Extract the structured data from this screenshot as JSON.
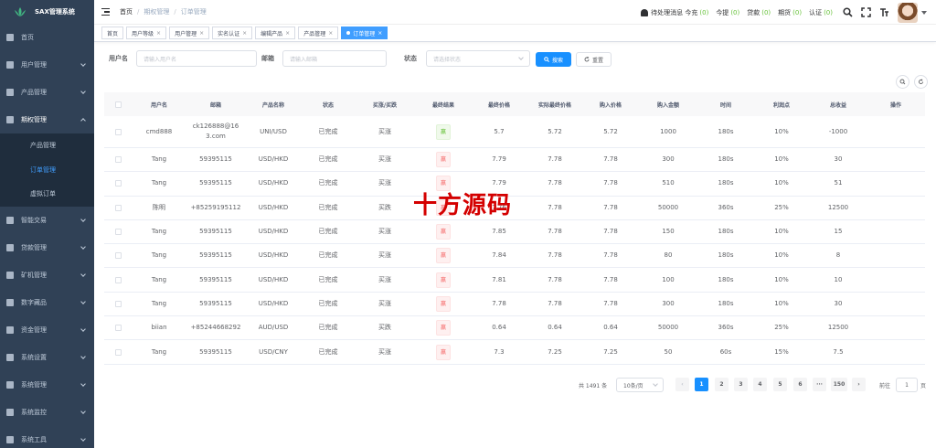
{
  "brand": "SAX管理系统",
  "sidebar": {
    "items": [
      {
        "label": "首页",
        "icon": "dashboard-icon",
        "expandable": false
      },
      {
        "label": "用户管理",
        "icon": "user-icon",
        "expandable": true
      },
      {
        "label": "产品管理",
        "icon": "product-icon",
        "expandable": true
      },
      {
        "label": "期权管理",
        "icon": "option-icon",
        "expandable": true,
        "open": true
      },
      {
        "label": "智能交易",
        "icon": "robot-icon",
        "expandable": true
      },
      {
        "label": "贷款管理",
        "icon": "loan-icon",
        "expandable": true
      },
      {
        "label": "矿机管理",
        "icon": "miner-icon",
        "expandable": true
      },
      {
        "label": "数字藏品",
        "icon": "nft-icon",
        "expandable": true
      },
      {
        "label": "资金管理",
        "icon": "wallet-icon",
        "expandable": true
      },
      {
        "label": "系统设置",
        "icon": "gear-icon",
        "expandable": true
      },
      {
        "label": "系统管理",
        "icon": "settings-icon",
        "expandable": true
      },
      {
        "label": "系统监控",
        "icon": "monitor-icon",
        "expandable": true
      },
      {
        "label": "系统工具",
        "icon": "tool-icon",
        "expandable": true
      }
    ],
    "submenu": [
      "产品管理",
      "订单管理",
      "虚拟订单"
    ]
  },
  "header": {
    "breadcrumb": [
      "首页",
      "期权管理",
      "订单管理"
    ],
    "pending_label": "待处理消息 今充",
    "counters": [
      {
        "label": "今提",
        "value": "(0)"
      },
      {
        "label": "贷款",
        "value": "(0)"
      },
      {
        "label": "期货",
        "value": "(0)"
      },
      {
        "label": "认证",
        "value": "(0)"
      }
    ],
    "pending_value": "(0)"
  },
  "tags": [
    {
      "label": "首页",
      "closable": false
    },
    {
      "label": "用户等级",
      "closable": true
    },
    {
      "label": "用户管理",
      "closable": true
    },
    {
      "label": "实名认证",
      "closable": true
    },
    {
      "label": "编辑产品",
      "closable": true
    },
    {
      "label": "产品管理",
      "closable": true
    },
    {
      "label": "订单管理",
      "closable": true,
      "active": true
    }
  ],
  "search": {
    "username_label": "用户名",
    "username_placeholder": "请输入用户名",
    "email_label": "邮箱",
    "email_placeholder": "请输入邮箱",
    "status_label": "状态",
    "status_placeholder": "请选择状态",
    "search_button": "搜索",
    "reset_button": "重置"
  },
  "table": {
    "columns": [
      "",
      "用户名",
      "邮箱",
      "产品名称",
      "状态",
      "买涨/买跌",
      "最终结果",
      "最终价格",
      "实际最终价格",
      "购入价格",
      "购入金额",
      "时间",
      "利润点",
      "总收益",
      "操作"
    ],
    "rows": [
      {
        "user": "cmd888",
        "email": "ck126888@163.com",
        "product": "UNI/USD",
        "status": "已完成",
        "dir": "买涨",
        "result": "赢",
        "result_type": "win",
        "final": "5.7",
        "actual": "5.72",
        "buy": "5.72",
        "amount": "1000",
        "time": "180s",
        "profit": "10%",
        "total": "-1000"
      },
      {
        "user": "Tang",
        "email": "59395115",
        "product": "USD/HKD",
        "status": "已完成",
        "dir": "买涨",
        "result": "赢",
        "result_type": "lose",
        "final": "7.79",
        "actual": "7.78",
        "buy": "7.78",
        "amount": "300",
        "time": "180s",
        "profit": "10%",
        "total": "30"
      },
      {
        "user": "Tang",
        "email": "59395115",
        "product": "USD/HKD",
        "status": "已完成",
        "dir": "买涨",
        "result": "赢",
        "result_type": "lose",
        "final": "7.79",
        "actual": "7.78",
        "buy": "7.78",
        "amount": "510",
        "time": "180s",
        "profit": "10%",
        "total": "51"
      },
      {
        "user": "陈明",
        "email": "+85259195112",
        "product": "USD/HKD",
        "status": "已完成",
        "dir": "买跌",
        "result": "赢",
        "result_type": "lose",
        "final": "7.76",
        "actual": "7.78",
        "buy": "7.78",
        "amount": "50000",
        "time": "360s",
        "profit": "25%",
        "total": "12500"
      },
      {
        "user": "Tang",
        "email": "59395115",
        "product": "USD/HKD",
        "status": "已完成",
        "dir": "买涨",
        "result": "赢",
        "result_type": "lose",
        "final": "7.85",
        "actual": "7.78",
        "buy": "7.78",
        "amount": "150",
        "time": "180s",
        "profit": "10%",
        "total": "15"
      },
      {
        "user": "Tang",
        "email": "59395115",
        "product": "USD/HKD",
        "status": "已完成",
        "dir": "买涨",
        "result": "赢",
        "result_type": "lose",
        "final": "7.84",
        "actual": "7.78",
        "buy": "7.78",
        "amount": "80",
        "time": "180s",
        "profit": "10%",
        "total": "8"
      },
      {
        "user": "Tang",
        "email": "59395115",
        "product": "USD/HKD",
        "status": "已完成",
        "dir": "买涨",
        "result": "赢",
        "result_type": "lose",
        "final": "7.81",
        "actual": "7.78",
        "buy": "7.78",
        "amount": "100",
        "time": "180s",
        "profit": "10%",
        "total": "10"
      },
      {
        "user": "Tang",
        "email": "59395115",
        "product": "USD/HKD",
        "status": "已完成",
        "dir": "买涨",
        "result": "赢",
        "result_type": "lose",
        "final": "7.78",
        "actual": "7.78",
        "buy": "7.78",
        "amount": "300",
        "time": "180s",
        "profit": "10%",
        "total": "30"
      },
      {
        "user": "biian",
        "email": "+85244668292",
        "product": "AUD/USD",
        "status": "已完成",
        "dir": "买跌",
        "result": "赢",
        "result_type": "lose",
        "final": "0.64",
        "actual": "0.64",
        "buy": "0.64",
        "amount": "50000",
        "time": "360s",
        "profit": "25%",
        "total": "12500"
      },
      {
        "user": "Tang",
        "email": "59395115",
        "product": "USD/CNY",
        "status": "已完成",
        "dir": "买涨",
        "result": "赢",
        "result_type": "lose",
        "final": "7.3",
        "actual": "7.25",
        "buy": "7.25",
        "amount": "50",
        "time": "60s",
        "profit": "15%",
        "total": "7.5"
      }
    ]
  },
  "pagination": {
    "total": "共 1491 条",
    "page_size": "10条/页",
    "pages": [
      "1",
      "2",
      "3",
      "4",
      "5",
      "6",
      "···",
      "150"
    ],
    "current": "1",
    "goto_label": "前往",
    "goto_value": "1",
    "page_suffix": "页"
  },
  "watermark": "十方源码",
  "colors": {
    "sidebar": "#304156",
    "primary": "#1890ff",
    "win": "#67c23a",
    "lose": "#f56c6c"
  }
}
